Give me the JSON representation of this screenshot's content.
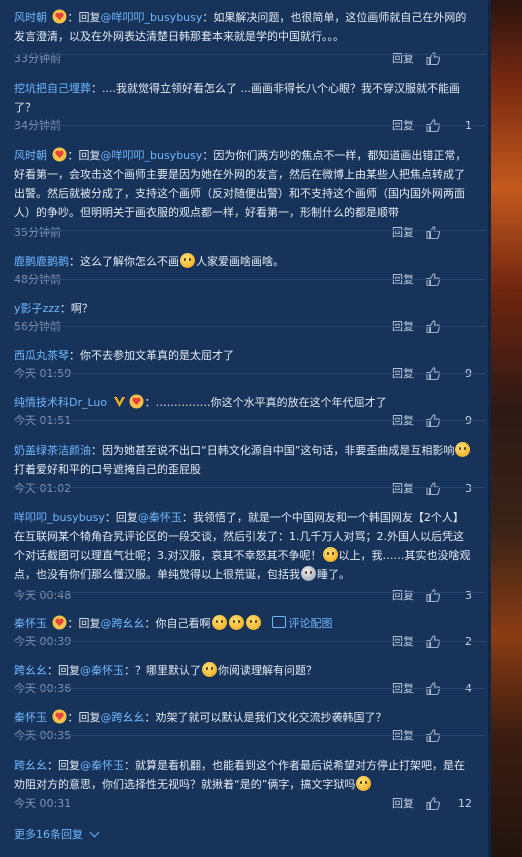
{
  "reply_label": "回复",
  "connector_reply": "：回复",
  "comments": [
    {
      "user": "风时朝",
      "badge": "heart-badge",
      "reply_to": "@咩叩叩_busybusy",
      "text": "：如果解决问题，也很简单，这位画师就自己在外网的发言澄清，以及在外网表达清楚日韩那套本来就是学的中国就行。。。",
      "time": "33分钟前",
      "likes": ""
    },
    {
      "user": "挖坑把自己埋葬",
      "text": "：....我就觉得立领好看怎么了 ...画画非得长八个心眼？我不穿汉服就不能画了？",
      "time": "34分钟前",
      "likes": "1"
    },
    {
      "user": "风时朝",
      "badge": "heart-badge",
      "reply_to": "@咩叩叩_busybusy",
      "text": "：因为你们两方吵的焦点不一样，都知道画出错正常，好看第一，会攻击这个画师主要是因为她在外网的发言，然后在微博上由某些人把焦点转成了出警。然后就被分成了，支持这个画师（反对随便出警）和不支持这个画师（国内国外网两面人）的争吵。但明明关于画衣服的观点都一样，好看第一，形制什么的都是顺带",
      "time": "35分钟前",
      "likes": ""
    },
    {
      "user": "鹿鹅鹿鹅鹅",
      "text_a": "：这么了解你怎么不画",
      "text_b": "人家爱画啥画啥。",
      "time": "48分钟前",
      "likes": ""
    },
    {
      "user": "y影子zzz",
      "text": "：啊？",
      "time": "56分钟前",
      "likes": ""
    },
    {
      "user": "西瓜丸茶琴",
      "text": "：你不去参加文革真的是太屈才了",
      "time": "今天 01:59",
      "likes": "9"
    },
    {
      "user": "纯情技术科Dr_Luo",
      "text": "：……………你这个水平真的放在这个年代屈才了",
      "time": "今天 01:51",
      "likes": "9"
    },
    {
      "user": "奶盖绿茶洁颜油",
      "text_a": "：因为她甚至说不出口“日韩文化源自中国”这句话，非要歪曲成是互相影响",
      "text_b": "打着爱好和平的口号遮掩自己的歪屁股",
      "time": "今天 01:02",
      "likes": "3"
    },
    {
      "user": "咩叩叩_busybusy",
      "reply_to": "@秦怀玉",
      "text_a": "：我领悟了，就是一个中国网友和一个韩国网友【2个人】在互联网某个犄角旮旯评论区的一段交谈，然后引发了：1.几千万人对骂；2.外国人以后凭这个对话截图可以理直气壮呢；3.对汉服，哀其不幸怒其不争呢！",
      "text_b": "以上，我……其实也没啥观点，也没有你们那么懂汉服。单纯觉得以上很荒诞，包括我",
      "text_c": "睡了。",
      "time": "今天 00:48",
      "likes": "3"
    },
    {
      "user": "秦怀玉",
      "badge": "heart-badge",
      "reply_to": "@跨幺幺",
      "text": "：你自己看啊",
      "link": "评论配图",
      "time": "今天 00:39",
      "likes": "2"
    },
    {
      "user": "跨幺幺",
      "reply_to": "@秦怀玉",
      "text_a": "：？哪里默认了",
      "text_b": "你阅读理解有问题？",
      "time": "今天 00:36",
      "likes": "4"
    },
    {
      "user": "秦怀玉",
      "badge": "heart-badge",
      "reply_to": "@跨幺幺",
      "text": "：劝架了就可以默认是我们文化交流抄袭韩国了？",
      "time": "今天 00:35",
      "likes": ""
    },
    {
      "user": "跨幺幺",
      "reply_to": "@秦怀玉",
      "text_a": "：就算是看机翻，也能看到这个作者最后说希望对方停止打架吧，是在劝阻对方的意思，你们选择性无视吗？就揪着“是的”俩字，搞文字狱吗",
      "time": "今天 00:31",
      "likes": "12"
    }
  ],
  "more_replies": "更多16条回复",
  "colors": {
    "background": "#17335a",
    "username": "#6fb7ff",
    "meta": "#7f94b3",
    "text": "#dfe7f2"
  }
}
